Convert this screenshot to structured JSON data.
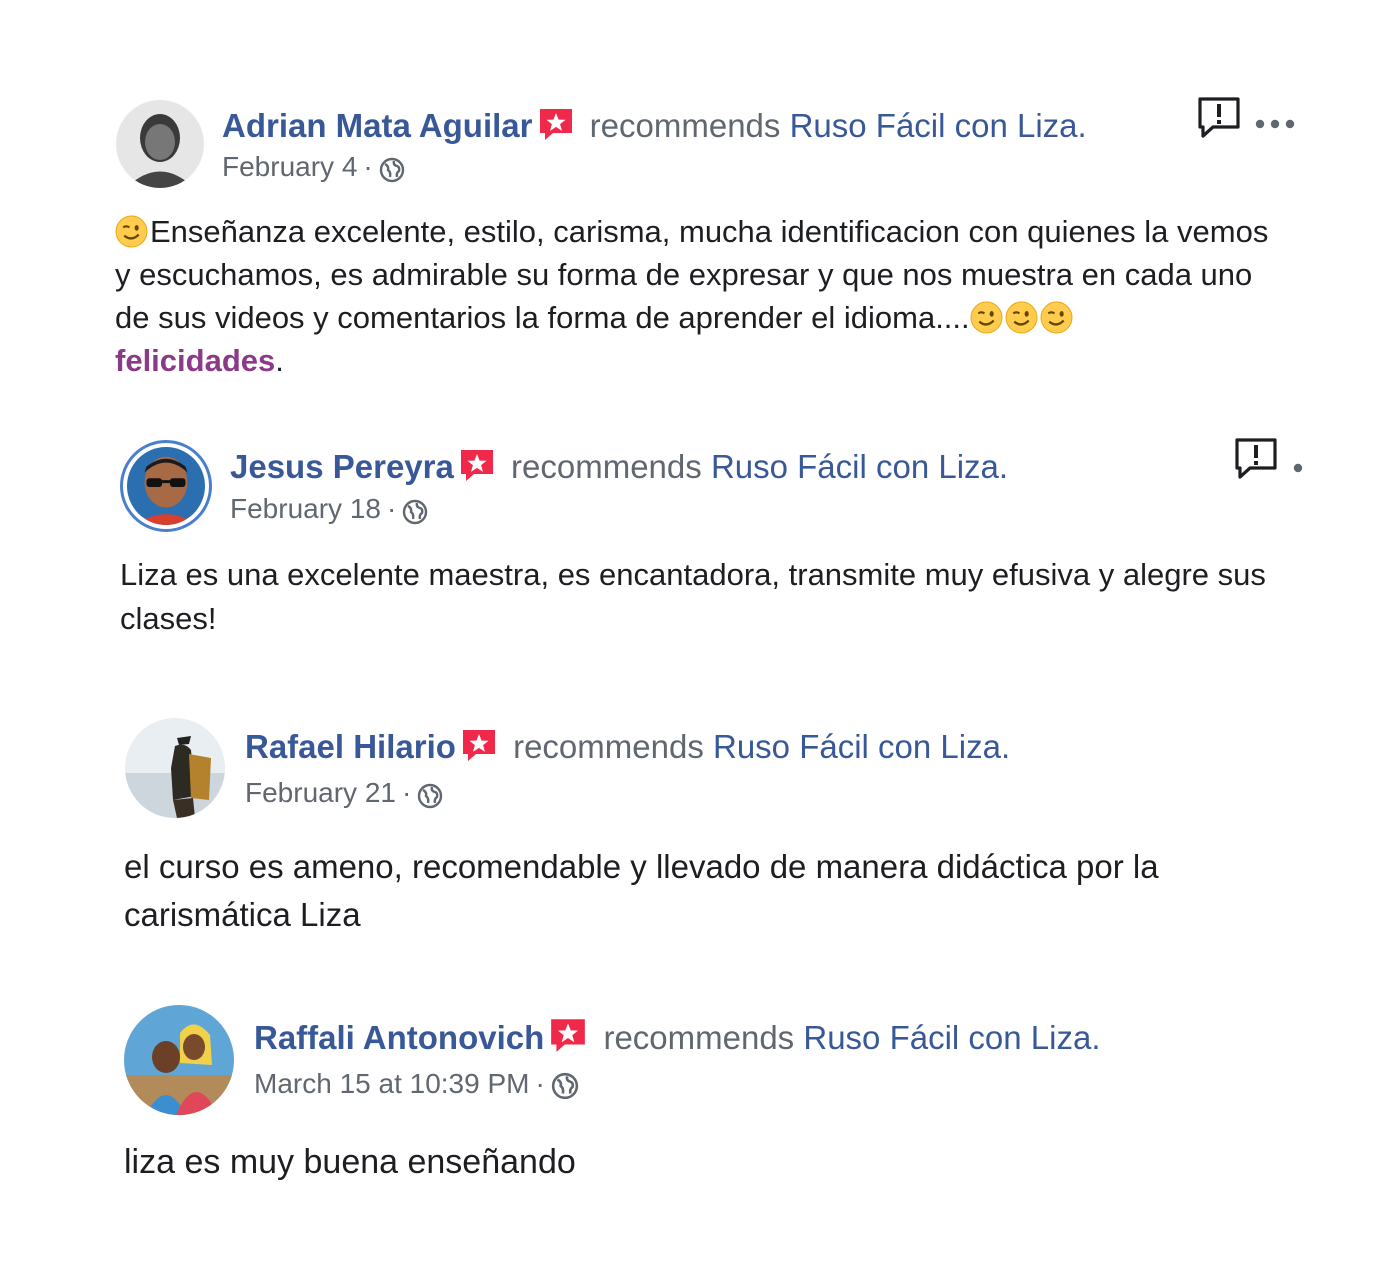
{
  "recommends_text": "recommends",
  "page_name": "Ruso Fácil con Liza",
  "period": ".",
  "separator": "·",
  "reviews": [
    {
      "author": "Adrian Mata Aguilar",
      "date": "February 4",
      "text_main": "Enseñanza excelente, estilo, carisma, mucha identificacion con quienes la vemos y escuchamos, es admirable su forma de expresar y que nos muestra en cada uno de sus videos y comentarios la forma de aprender el idioma....",
      "hashtag": "felicidades",
      "text_end": "."
    },
    {
      "author": "Jesus Pereyra",
      "date": "February 18",
      "text": "Liza es una excelente maestra, es encantadora, transmite muy efusiva y alegre sus clases!"
    },
    {
      "author": "Rafael Hilario",
      "date": "February 21",
      "text": "el curso es ameno, recomendable y llevado de manera didáctica por la carismática Liza"
    },
    {
      "author": "Raffali Antonovich",
      "date": "March 15 at 10:39 PM",
      "text": "liza es muy buena enseñando"
    }
  ],
  "icons": {
    "recommend_badge": "recommend-star-icon",
    "privacy": "globe-icon",
    "report": "report-icon",
    "more": "more-icon",
    "emoji": "wink-emoji"
  },
  "colors": {
    "link_blue": "#385898",
    "meta_gray": "#616770",
    "text": "#1c1e21",
    "hashtag": "#8b3a87",
    "badge_red": "#f0284a"
  }
}
